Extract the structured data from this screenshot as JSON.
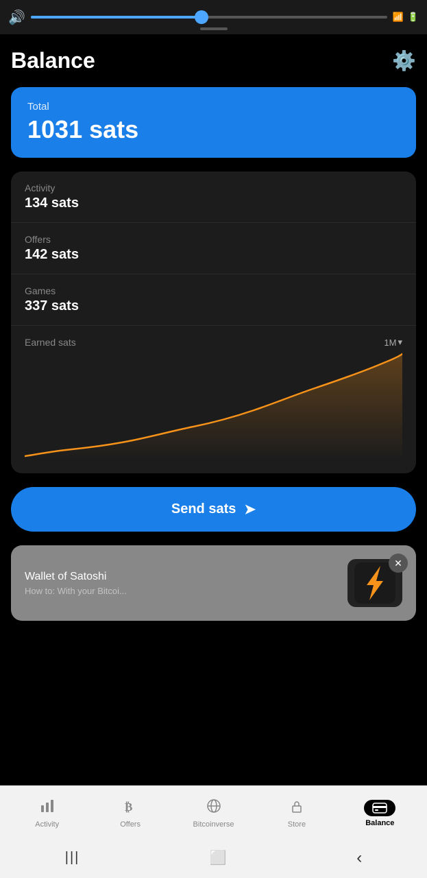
{
  "statusBar": {
    "progressPercent": 48
  },
  "header": {
    "title": "Balance",
    "settingsLabel": "settings"
  },
  "totalCard": {
    "label": "Total",
    "amount": "1031 sats"
  },
  "breakdown": [
    {
      "label": "Activity",
      "amount": "134 sats"
    },
    {
      "label": "Offers",
      "amount": "142 sats"
    },
    {
      "label": "Games",
      "amount": "337 sats"
    }
  ],
  "chart": {
    "title": "Earned sats",
    "filter": "1M",
    "color": "#f7931a"
  },
  "sendButton": {
    "label": "Send sats"
  },
  "walletCard": {
    "name": "Wallet of Satoshi",
    "subtext": "How to: With your Bitcoin..."
  },
  "bottomNav": {
    "items": [
      {
        "id": "activity",
        "label": "Activity",
        "icon": "📊",
        "active": false
      },
      {
        "id": "offers",
        "label": "Offers",
        "icon": "₿",
        "active": false
      },
      {
        "id": "bitcoinverse",
        "label": "Bitcoinverse",
        "icon": "🌐",
        "active": false
      },
      {
        "id": "store",
        "label": "Store",
        "icon": "🔒",
        "active": false
      },
      {
        "id": "balance",
        "label": "Balance",
        "icon": "💳",
        "active": true
      }
    ]
  },
  "phoneNav": {
    "menuIcon": "☰",
    "homeIcon": "⬜",
    "backIcon": "‹"
  }
}
